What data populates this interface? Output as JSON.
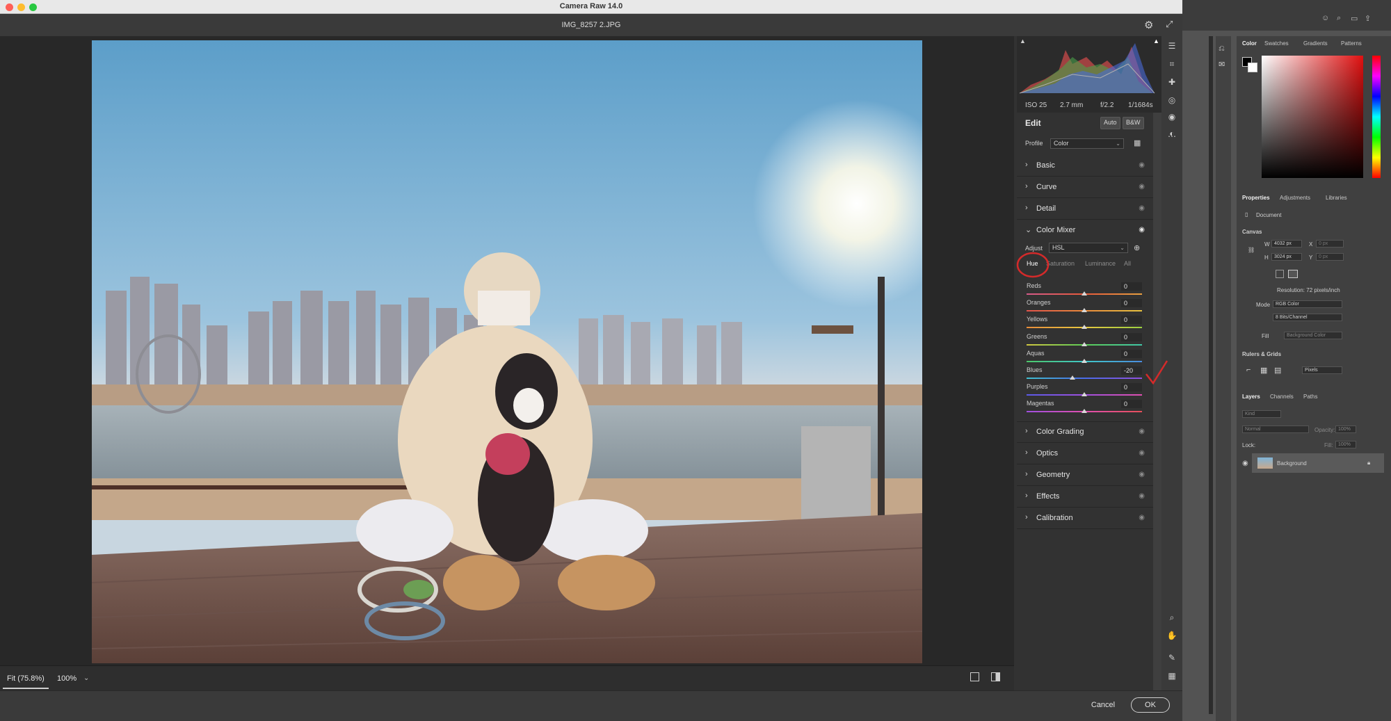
{
  "window": {
    "title": "Camera Raw 14.0",
    "file_name": "IMG_8257 2.JPG"
  },
  "histogram": {
    "exif": {
      "iso": "ISO 25",
      "focal": "2.7 mm",
      "aperture": "f/2.2",
      "shutter": "1/1684s"
    }
  },
  "edit": {
    "title": "Edit",
    "auto_label": "Auto",
    "bw_label": "B&W",
    "profile_label": "Profile",
    "profile_value": "Color"
  },
  "sections_top": [
    {
      "label": "Basic"
    },
    {
      "label": "Curve"
    },
    {
      "label": "Detail"
    }
  ],
  "color_mixer": {
    "label": "Color Mixer",
    "adjust_label": "Adjust",
    "adjust_value": "HSL",
    "tabs": [
      "Hue",
      "Saturation",
      "Luminance",
      "All"
    ],
    "active_tab": "Hue",
    "sliders": [
      {
        "label": "Reds",
        "value": "0",
        "num": 0,
        "colors": [
          "#d65a8a",
          "#e85a3a",
          "#e8a040"
        ]
      },
      {
        "label": "Oranges",
        "value": "0",
        "num": 0,
        "colors": [
          "#e2534a",
          "#eb8a3b",
          "#e8c340"
        ]
      },
      {
        "label": "Yellows",
        "value": "0",
        "num": 0,
        "colors": [
          "#e88c3a",
          "#e8c840",
          "#9cd040"
        ]
      },
      {
        "label": "Greens",
        "value": "0",
        "num": 0,
        "colors": [
          "#d0c840",
          "#5ccc55",
          "#40c8a8"
        ]
      },
      {
        "label": "Aquas",
        "value": "0",
        "num": 0,
        "colors": [
          "#4cc86a",
          "#40c8c8",
          "#4a8ce0"
        ]
      },
      {
        "label": "Blues",
        "value": "-20",
        "num": -20,
        "colors": [
          "#40c0d0",
          "#4a6ce8",
          "#9050e0"
        ]
      },
      {
        "label": "Purples",
        "value": "0",
        "num": 0,
        "colors": [
          "#5a5ae8",
          "#a050e0",
          "#e050b0"
        ]
      },
      {
        "label": "Magentas",
        "value": "0",
        "num": 0,
        "colors": [
          "#a050e0",
          "#e050b0",
          "#e8505a"
        ]
      }
    ]
  },
  "sections_bottom": [
    {
      "label": "Color Grading"
    },
    {
      "label": "Optics"
    },
    {
      "label": "Geometry"
    },
    {
      "label": "Effects"
    },
    {
      "label": "Calibration"
    }
  ],
  "bottom_bar": {
    "fit_label": "Fit (75.8%)",
    "zoom_label": "100%"
  },
  "footer": {
    "cancel_label": "Cancel",
    "ok_label": "OK"
  },
  "photoshop": {
    "color_tabs": [
      "Color",
      "Swatches",
      "Gradients",
      "Patterns"
    ],
    "properties_tabs": [
      "Properties",
      "Adjustments",
      "Libraries"
    ],
    "document_label": "Document",
    "canvas_label": "Canvas",
    "w_label": "W",
    "w_value": "4032 px",
    "h_label": "H",
    "h_value": "3024 px",
    "x_label": "X",
    "x_value": "0 px",
    "y_label": "Y",
    "y_value": "0 px",
    "resolution": "Resolution: 72 pixels/inch",
    "mode_label": "Mode",
    "mode_value": "RGB Color",
    "bits_value": "8 Bits/Channel",
    "fill_label": "Fill",
    "fill_value": "Background Color",
    "rulers_label": "Rulers & Grids",
    "units_value": "Pixels",
    "layers_tabs": [
      "Layers",
      "Channels",
      "Paths"
    ],
    "kind_label": "Kind",
    "blend_value": "Normal",
    "opacity_label": "Opacity:",
    "opacity_value": "100%",
    "lock_label": "Lock:",
    "fill2_label": "Fill:",
    "fill2_value": "100%",
    "layer_name": "Background"
  },
  "colors": {
    "dialog_bg": "#3f3f3f",
    "panel_bg": "#323232",
    "annotation_red": "#d42a2a"
  }
}
